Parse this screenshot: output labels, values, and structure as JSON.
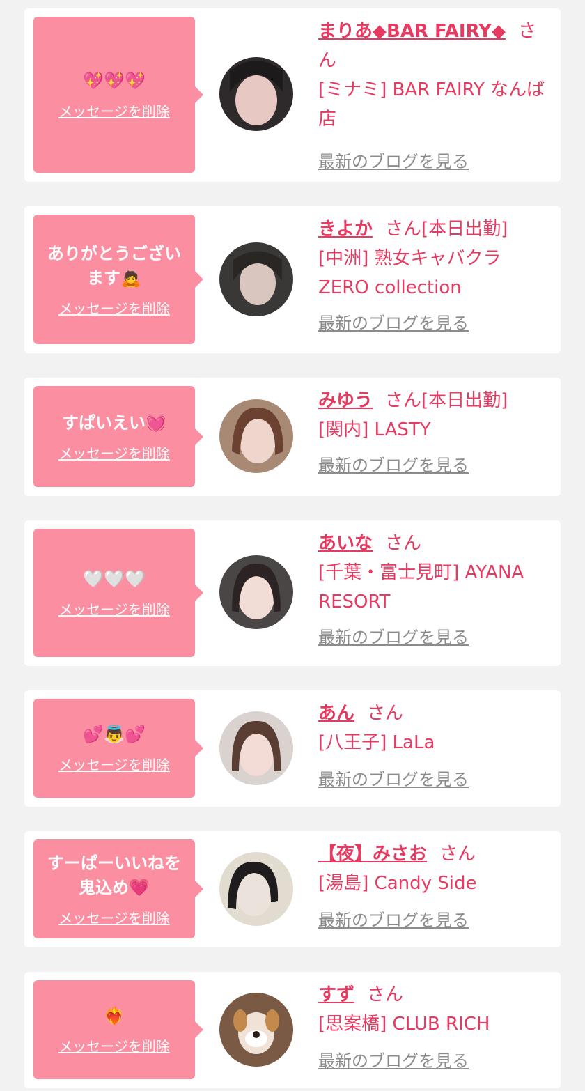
{
  "common": {
    "delete_label": "メッセージを削除",
    "blog_label": "最新のブログを見る",
    "san_label": "さん"
  },
  "items": [
    {
      "message": "💖💖💖",
      "name": "まりあ◆BAR FAIRY◆",
      "status": "",
      "shop": "[ミナミ] BAR FAIRY なんば店"
    },
    {
      "message": "ありがとうございます🙇",
      "name": "きよか",
      "status": "[本日出勤]",
      "shop": "[中洲] 熟女キャバクラ ZERO collection"
    },
    {
      "message": "すぱいえい💓",
      "name": "みゆう",
      "status": "[本日出勤]",
      "shop": "[関内] LASTY"
    },
    {
      "message": "🤍🤍🤍",
      "name": "あいな",
      "status": "",
      "shop": "[千葉・富士見町] AYANA RESORT"
    },
    {
      "message": "💕👼💕",
      "name": "あん",
      "status": "",
      "shop": "[八王子] LaLa"
    },
    {
      "message": "すーぱーいいねを鬼込め💗",
      "name": "【夜】みさお",
      "status": "",
      "shop": "[湯島] Candy Side"
    },
    {
      "message": "❤️‍🔥",
      "name": "すず",
      "status": "",
      "shop": "[思案橋] CLUB RICH"
    }
  ]
}
